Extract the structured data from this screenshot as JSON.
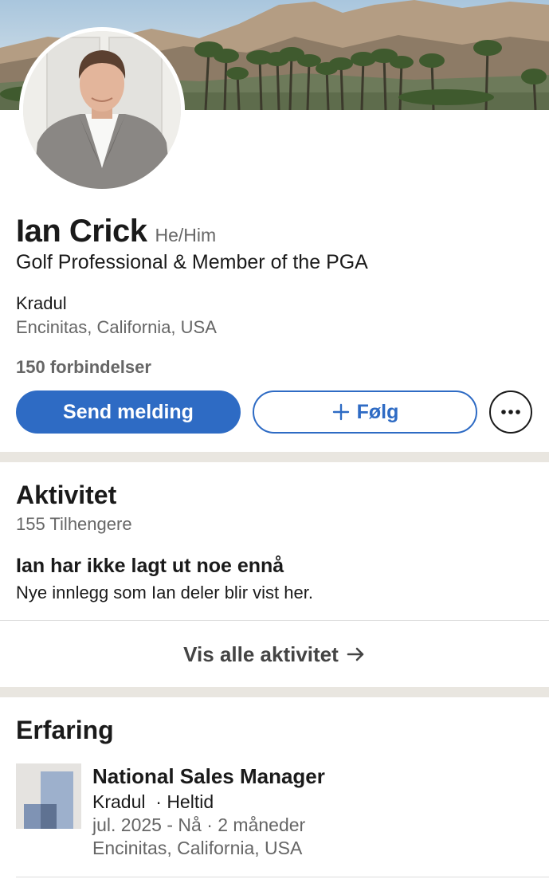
{
  "profile": {
    "name": "Ian Crick",
    "pronouns": "He/Him",
    "headline": "Golf Professional & Member of the PGA",
    "company": "Kradul",
    "location": "Encinitas, California, USA",
    "connections": "150 forbindelser"
  },
  "actions": {
    "message_label": "Send melding",
    "follow_label": "Følg",
    "follow_icon": "plus-icon",
    "more_icon": "more-horizontal-icon"
  },
  "activity": {
    "title": "Aktivitet",
    "followers": "155 Tilhengere",
    "empty_title": "Ian har ikke lagt ut noe ennå",
    "empty_subtitle": "Nye innlegg som Ian deler blir vist her.",
    "show_all_label": "Vis alle aktivitet",
    "show_all_icon": "arrow-right-icon"
  },
  "experience": {
    "title": "Erfaring",
    "items": [
      {
        "role": "National Sales Manager",
        "company_line": "Kradul  · Heltid",
        "dates": "jul. 2025 - Nå · 2 måneder",
        "location": "Encinitas, California, USA"
      }
    ]
  },
  "colors": {
    "accent": "#2e6bc4",
    "divider": "#e9e6e0",
    "secondary_text": "#666666"
  }
}
